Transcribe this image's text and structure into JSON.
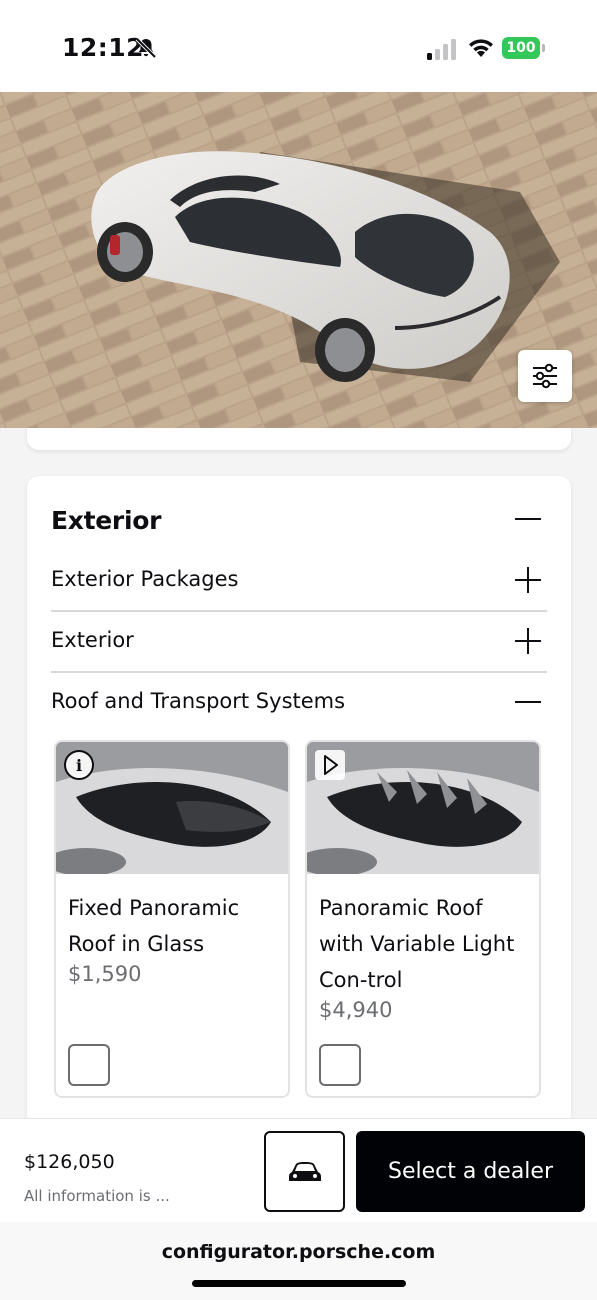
{
  "status_bar": {
    "time": "12:12",
    "battery": "100",
    "icons": [
      "bell-slash-icon",
      "signal-icon",
      "wifi-icon",
      "battery-icon"
    ]
  },
  "hero": {
    "description_icon": "car-top-view-image",
    "filter_icon": "sliders-icon"
  },
  "exterior": {
    "title": "Exterior",
    "rows": [
      {
        "label": "Exterior Packages",
        "state": "collapsed"
      },
      {
        "label": "Exterior",
        "state": "collapsed"
      },
      {
        "label": "Roof and Transport Systems",
        "state": "expanded"
      }
    ],
    "options": [
      {
        "name": "Fixed Panoramic Roof in Glass",
        "price": "$1,590",
        "badge_icon": "info-icon",
        "checked": false
      },
      {
        "name": "Panoramic Roof with Variable Light Con-trol",
        "price": "$4,940",
        "badge_icon": "play-icon",
        "checked": false
      }
    ]
  },
  "bottom_bar": {
    "total": "$126,050",
    "info": "All information is ...",
    "car_button_icon": "car-front-icon",
    "dealer_button": "Select a dealer"
  },
  "browser": {
    "url": "configurator.porsche.com"
  },
  "colors": {
    "accent_black": "#010205",
    "battery_green": "#34c759",
    "muted_text": "#6b6d70"
  }
}
